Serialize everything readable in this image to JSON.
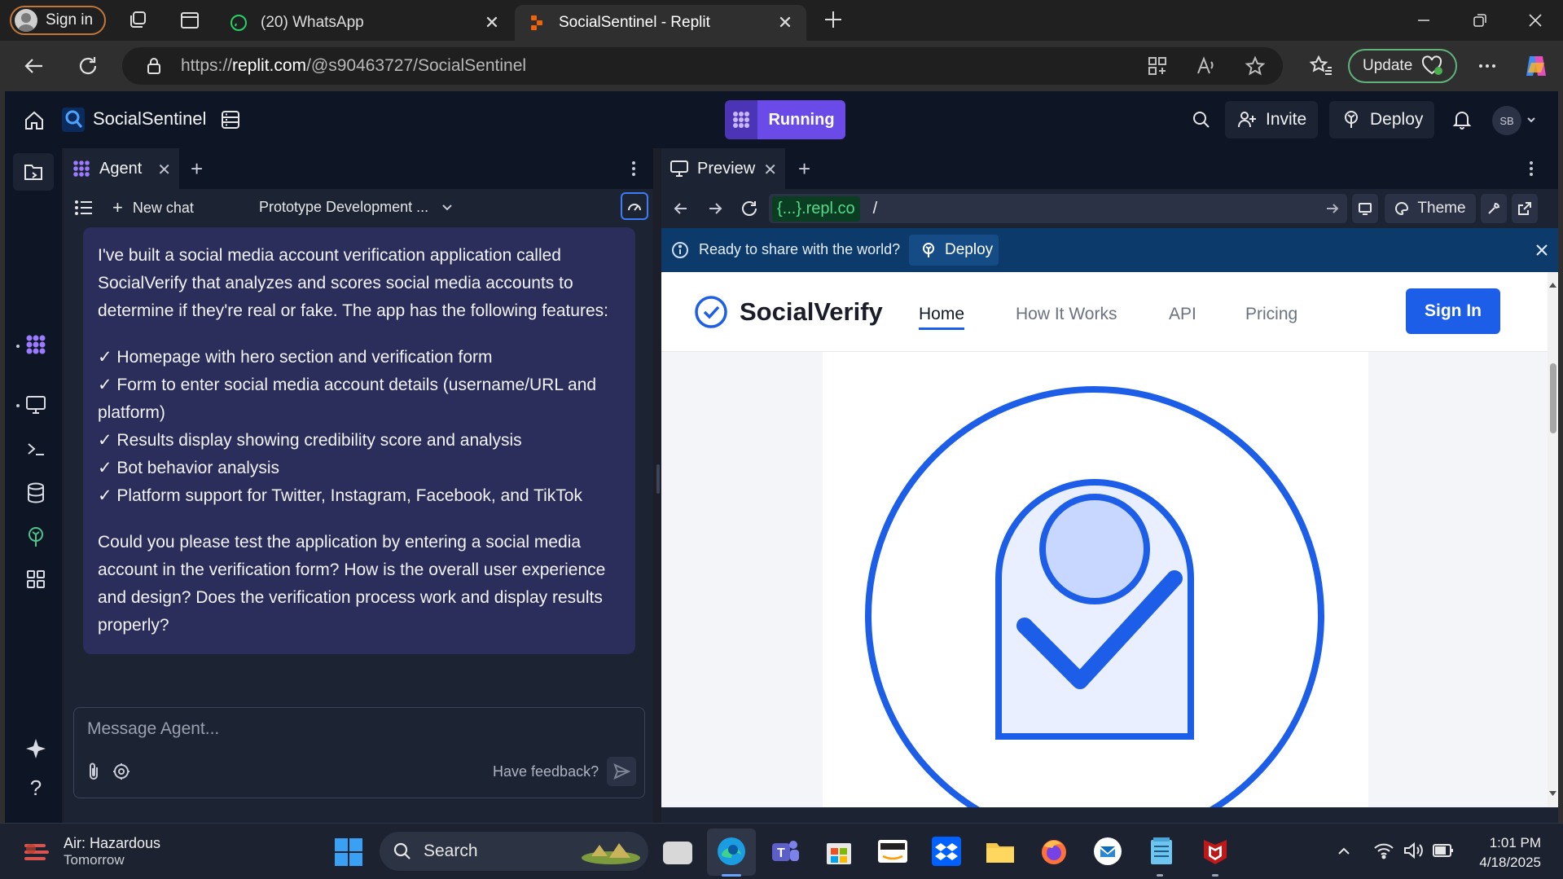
{
  "browser": {
    "signin_label": "Sign in",
    "tabs": [
      {
        "label": "(20) WhatsApp"
      },
      {
        "label": "SocialSentinel - Replit"
      }
    ],
    "url_prefix": "https://",
    "url_host": "replit.com",
    "url_path": "/@s90463727/SocialSentinel",
    "update_label": "Update"
  },
  "replit": {
    "project_name": "SocialSentinel",
    "run_label": "Running",
    "invite_label": "Invite",
    "deploy_label": "Deploy",
    "user_initials": "SB"
  },
  "agent": {
    "tab_label": "Agent",
    "new_chat_label": "New chat",
    "thread_title": "Prototype Development ...",
    "message_paragraph_1": "I've built a social media account verification application called SocialVerify that analyzes and scores social media accounts to determine if they're real or fake. The app has the following features:",
    "features": [
      "✓ Homepage with hero section and verification form",
      "✓ Form to enter social media account details (username/URL and platform)",
      "✓ Results display showing credibility score and analysis",
      "✓ Bot behavior analysis",
      "✓ Platform support for Twitter, Instagram, Facebook, and TikTok"
    ],
    "message_paragraph_2": "Could you please test the application by entering a social media account in the verification form? How is the overall user experience and design? Does the verification process work and display results properly?",
    "input_placeholder": "Message Agent...",
    "feedback_label": "Have feedback?"
  },
  "preview": {
    "tab_label": "Preview",
    "url_host": "{...}.repl.co",
    "url_path": "/",
    "theme_label": "Theme",
    "share_text": "Ready to share with the world?",
    "share_deploy_label": "Deploy"
  },
  "webapp": {
    "brand": "SocialVerify",
    "nav": [
      "Home",
      "How It Works",
      "API",
      "Pricing"
    ],
    "signin_label": "Sign In",
    "accent": "#1d5ee8"
  },
  "taskbar": {
    "weather_title": "Air: Hazardous",
    "weather_sub": "Tomorrow",
    "search_label": "Search",
    "time": "1:01 PM",
    "date": "4/18/2025"
  }
}
